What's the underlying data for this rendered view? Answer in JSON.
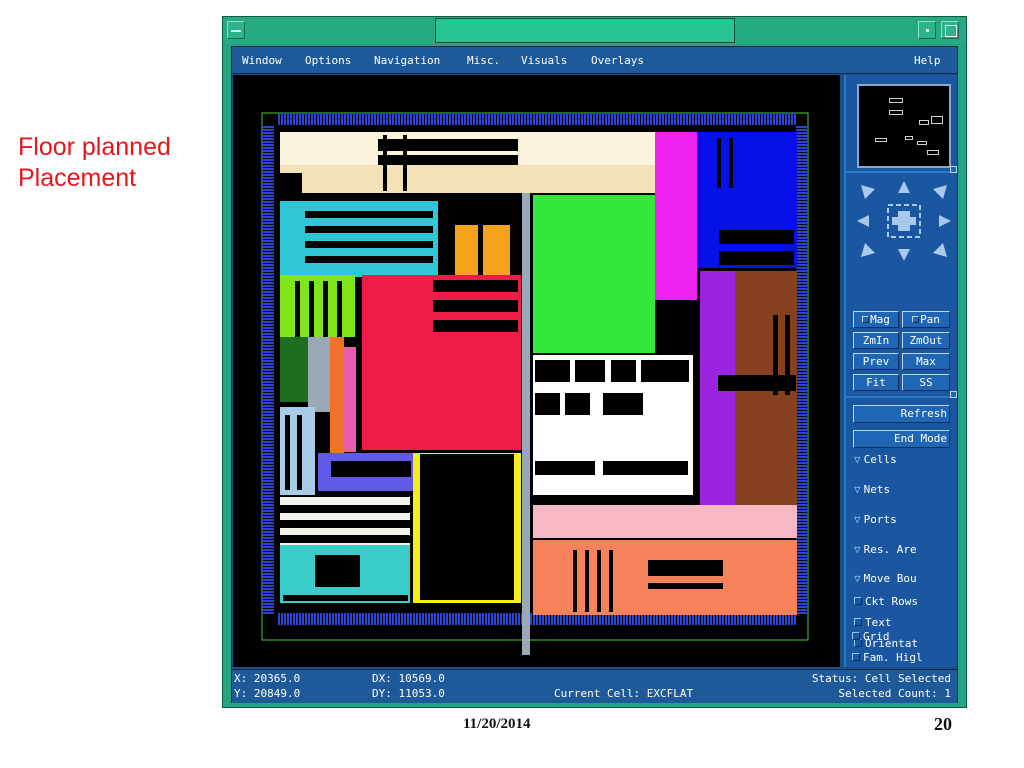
{
  "slide": {
    "caption_lines": [
      "Floor planned",
      "Placement"
    ],
    "footer_date": "11/20/2014",
    "page_number": "20",
    "caption_color": "#e8151b"
  },
  "window": {
    "menu": [
      "Window",
      "Options",
      "Navigation",
      "Misc.",
      "Visuals",
      "Overlays"
    ],
    "help": "Help"
  },
  "layout_view": {
    "description_icon": "chip-floorplan",
    "region_colors": {
      "cream": "#fbf4dc",
      "tan": "#f3e1b8",
      "cyan": "#2fc7d6",
      "orange": "#f5a21f",
      "green": "#33e83a",
      "magenta": "#ee22ee",
      "blue": "#0610e8",
      "lime": "#7fe61a",
      "red": "#ee1c47",
      "purple": "#9b24e0",
      "brown": "#84401f",
      "white": "#ffffff",
      "pink": "#f7b8c6",
      "salmon": "#f5825a",
      "teal": "#39cdc9",
      "lightblue": "#a8cbe8",
      "indigo": "#5f5be6",
      "yellow": "#f5ee1a",
      "grey": "#9aa9b8",
      "darkgreen": "#1f6e1f",
      "io_ring": "#2340c8"
    }
  },
  "side_panel": {
    "nav_buttons": [
      {
        "label": "Mag",
        "checkbox": true
      },
      {
        "label": "Pan",
        "checkbox": true
      },
      {
        "label": "ZmIn",
        "checkbox": false
      },
      {
        "label": "ZmOut",
        "checkbox": false
      },
      {
        "label": "Prev",
        "checkbox": false
      },
      {
        "label": "Max",
        "checkbox": false
      },
      {
        "label": "Fit",
        "checkbox": false
      },
      {
        "label": "SS",
        "checkbox": false
      }
    ],
    "refresh": "Refresh",
    "end_mode": "End Mode",
    "expanders": [
      "Cells",
      "Nets",
      "Ports",
      "Res. Are",
      "Move Bou"
    ],
    "checks": [
      "Ckt Rows",
      "Text",
      "Orientat",
      "Grid",
      "Fam. Higl"
    ]
  },
  "status": {
    "x": "X: 20365.0",
    "y": "Y: 20849.0",
    "dx": "DX: 10569.0",
    "dy": "DY: 11053.0",
    "current_cell": "Current Cell: EXCFLAT",
    "status_text": "Status: Cell Selected",
    "selected_count": "Selected Count: 1"
  }
}
